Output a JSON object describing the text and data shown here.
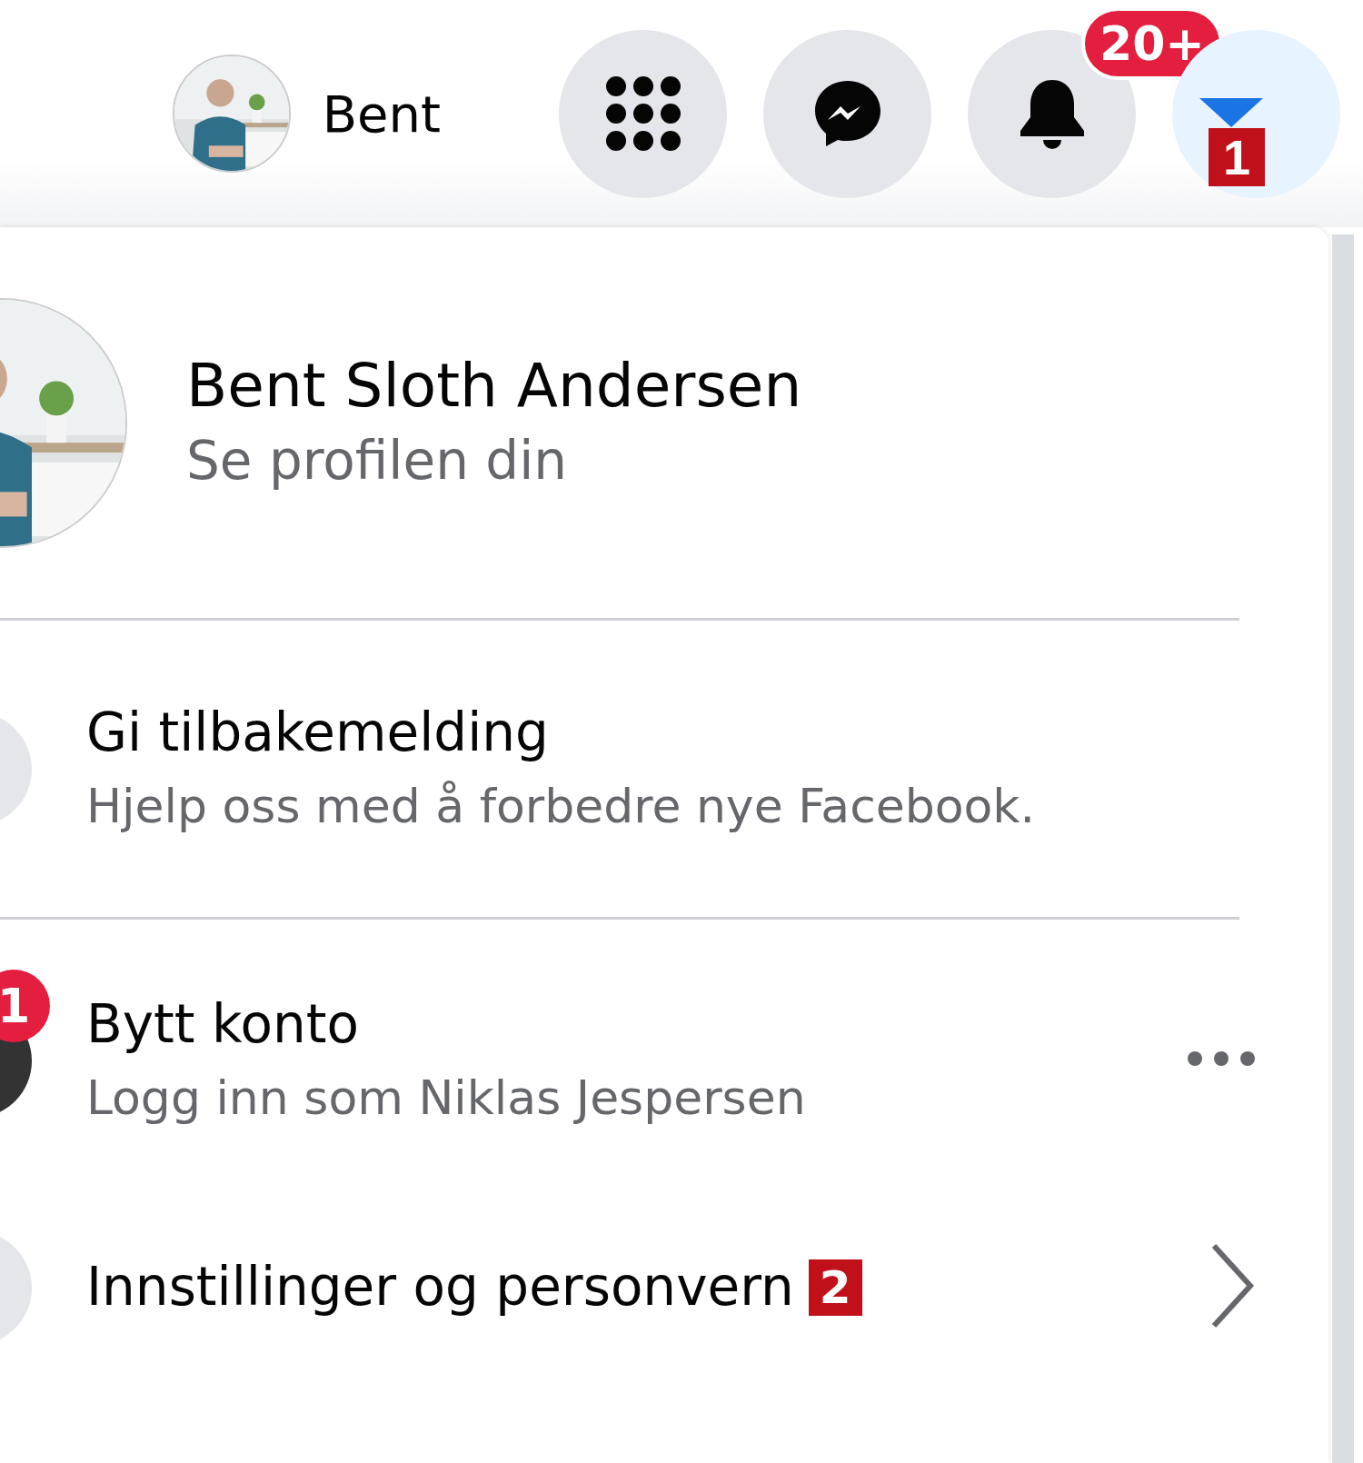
{
  "top_bar": {
    "profile": {
      "name": "Bent"
    },
    "buttons": [
      {
        "kind": "menu",
        "active": false
      },
      {
        "kind": "messenger",
        "active": false
      },
      {
        "kind": "notifications",
        "active": false,
        "badge": "20+"
      },
      {
        "kind": "account",
        "active": true,
        "marker": "1"
      }
    ]
  },
  "menu": {
    "profile": {
      "name": "Bent Sloth Andersen",
      "subtitle": "Se profilen din"
    },
    "items": [
      {
        "kind": "feedback",
        "title": "Gi tilbakemelding",
        "subtitle": "Hjelp oss med å forbedre nye Facebook."
      },
      {
        "kind": "switch",
        "title": "Bytt konto",
        "subtitle": "Logg inn som Niklas Jespersen",
        "badge": "1"
      },
      {
        "kind": "settings",
        "title": "Innstillinger og personvern",
        "marker": "2"
      }
    ]
  }
}
